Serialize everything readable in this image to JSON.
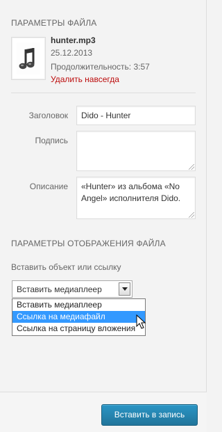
{
  "attachment_details": {
    "heading": "ПАРАМЕТРЫ ФАЙЛА",
    "file_name": "hunter.mp3",
    "date": "25.12.2013",
    "length": "Продолжительность: 3:57",
    "delete_link": "Удалить навсегда",
    "thumbnail_icon": "audio-file-icon"
  },
  "fields": {
    "title_label": "Заголовок",
    "title_value": "Dido - Hunter",
    "caption_label": "Подпись",
    "caption_value": "",
    "description_label": "Описание",
    "description_value": "«Hunter» из альбома «No Angel» исполнителя Dido."
  },
  "display_settings": {
    "heading": "ПАРАМЕТРЫ ОТОБРАЖЕНИЯ ФАЙЛА",
    "embed_label": "Вставить объект или ссылку",
    "selected": "Вставить медиаплеер",
    "options": [
      "Вставить медиаплеер",
      "Ссылка на медиафайл",
      "Ссылка на страницу вложения"
    ]
  },
  "footer": {
    "insert_button": "Вставить в запись"
  },
  "colors": {
    "delete_link": "#bc0b0b",
    "primary_button": "#2a95c5",
    "dropdown_highlight": "#3399ff"
  }
}
